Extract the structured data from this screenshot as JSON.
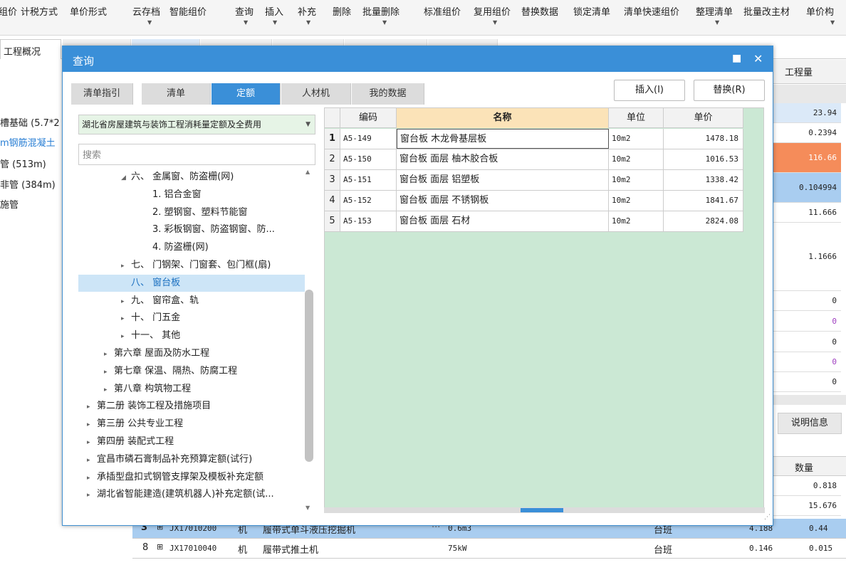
{
  "toolbar": {
    "items": [
      "组价",
      "计税方式",
      "单价形式",
      "云存档",
      "智能组价",
      "查询",
      "插入",
      "补充",
      "删除",
      "批量删除",
      "标准组价",
      "复用组价",
      "替换数据",
      "锁定清单",
      "清单快速组价",
      "整理清单",
      "批量改主材",
      "单价构"
    ]
  },
  "background": {
    "overview_tab": "工程概况",
    "left_items": [
      "槽基础 (5.7*2",
      "m钢筋混凝土",
      "管 (513m)",
      "非管 (384m)",
      "施管"
    ],
    "right_header": "工程量",
    "right_values": [
      "23.94",
      "0.2394",
      "116.66",
      "0.104994",
      "11.666",
      "1.1666",
      "0",
      "0",
      "0",
      "0",
      "0"
    ],
    "right_info_tab": "说明信息",
    "right_qty_header": "数量",
    "right_qty_values": [
      "0.818",
      "15.676"
    ],
    "bottom_rows": [
      {
        "no": "3",
        "code": "JX17010200",
        "type": "机",
        "name": "履带式单斗液压挖掘机",
        "spec": "0.6m3",
        "unit": "台班",
        "v1": "4.188",
        "v2": "0.44"
      },
      {
        "no": "8",
        "code": "JX17010040",
        "type": "机",
        "name": "履带式推土机",
        "spec": "75kW",
        "unit": "台班",
        "v1": "0.146",
        "v2": "0.015"
      }
    ]
  },
  "dialog": {
    "title": "查询",
    "tabs": [
      "清单指引",
      "清单",
      "定额",
      "人材机",
      "我的数据"
    ],
    "active_tab": 2,
    "insert_label": "插入(I)",
    "replace_label": "替换(R)",
    "library": "湖北省房屋建筑与装饰工程消耗量定额及全费用",
    "search_placeholder": "搜索",
    "tree": [
      {
        "label": "六、 金属窗、防盗栅(网)",
        "arrow": "◢",
        "indent": 60
      },
      {
        "label": "1. 铝合金窗",
        "arrow": "",
        "indent": 90
      },
      {
        "label": "2. 塑钢窗、塑料节能窗",
        "arrow": "",
        "indent": 90
      },
      {
        "label": "3. 彩板钢窗、防盗钢窗、防...",
        "arrow": "",
        "indent": 90
      },
      {
        "label": "4. 防盗栅(网)",
        "arrow": "",
        "indent": 90
      },
      {
        "label": "七、 门钢架、门窗套、包门框(扇)",
        "arrow": "▸",
        "indent": 60
      },
      {
        "label": "八、 窗台板",
        "arrow": "",
        "indent": 60
      },
      {
        "label": "九、 窗帘盒、轨",
        "arrow": "▸",
        "indent": 60
      },
      {
        "label": "十、 门五金",
        "arrow": "▸",
        "indent": 60
      },
      {
        "label": "十一、 其他",
        "arrow": "▸",
        "indent": 60
      },
      {
        "label": "第六章 屋面及防水工程",
        "arrow": "▸",
        "indent": 36
      },
      {
        "label": "第七章 保温、隔热、防腐工程",
        "arrow": "▸",
        "indent": 36
      },
      {
        "label": "第八章 构筑物工程",
        "arrow": "▸",
        "indent": 36
      },
      {
        "label": "第二册 装饰工程及措施项目",
        "arrow": "▸",
        "indent": 12
      },
      {
        "label": "第三册 公共专业工程",
        "arrow": "▸",
        "indent": 12
      },
      {
        "label": "第四册 装配式工程",
        "arrow": "▸",
        "indent": 12
      },
      {
        "label": "宜昌市磷石膏制品补充预算定额(试行)",
        "arrow": "▸",
        "indent": 12
      },
      {
        "label": "承插型盘扣式钢管支撑架及模板补充定额",
        "arrow": "▸",
        "indent": 12
      },
      {
        "label": "湖北省智能建造(建筑机器人)补充定额(试...",
        "arrow": "▸",
        "indent": 12
      }
    ],
    "selected_tree_index": 6,
    "grid": {
      "headers": [
        "编码",
        "名称",
        "单位",
        "单价"
      ],
      "rows": [
        {
          "no": "1",
          "code": "A5-149",
          "name": "窗台板 木龙骨基层板",
          "unit": "10m2",
          "price": "1478.18"
        },
        {
          "no": "2",
          "code": "A5-150",
          "name": "窗台板 面层 柚木胶合板",
          "unit": "10m2",
          "price": "1016.53"
        },
        {
          "no": "3",
          "code": "A5-151",
          "name": "窗台板 面层 铝塑板",
          "unit": "10m2",
          "price": "1338.42"
        },
        {
          "no": "4",
          "code": "A5-152",
          "name": "窗台板 面层 不锈钢板",
          "unit": "10m2",
          "price": "1841.67"
        },
        {
          "no": "5",
          "code": "A5-153",
          "name": "窗台板 面层 石材",
          "unit": "10m2",
          "price": "2824.08"
        }
      ]
    }
  },
  "colors": {
    "accent": "#3a8fd8",
    "grid_bg": "#cbe8d4",
    "selected_tree": "#cde5f7",
    "highlight_orange": "#f58c5a",
    "select_bg": "#e6f4e6"
  }
}
